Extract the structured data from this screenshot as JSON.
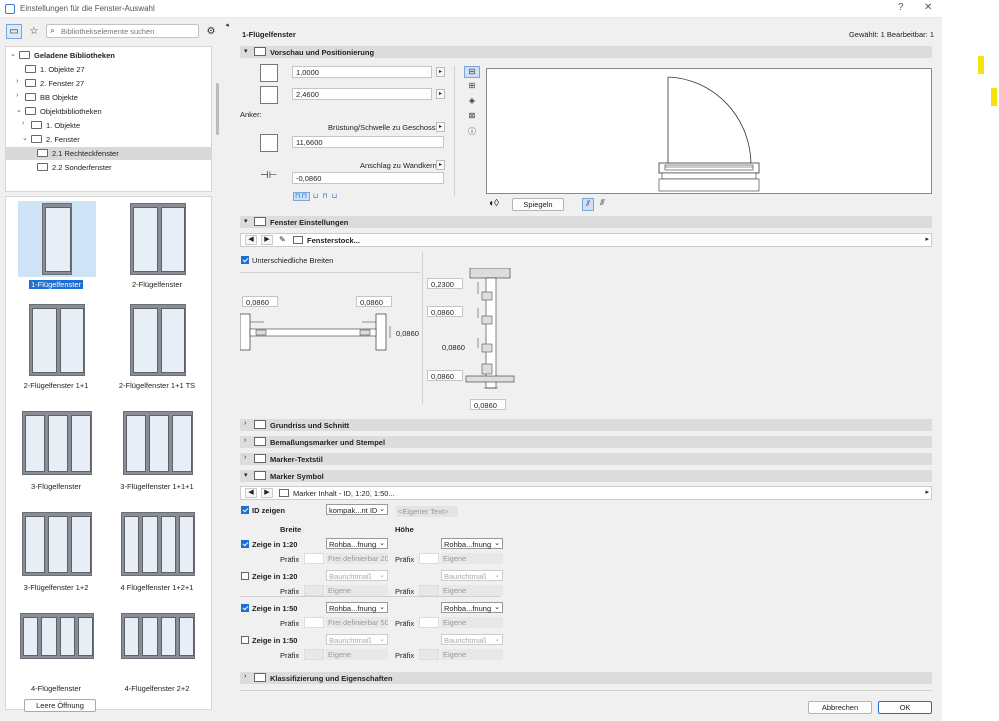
{
  "window": {
    "title": "Einstellungen für die Fenster-Auswahl",
    "help": "?",
    "close": "✕"
  },
  "left": {
    "search_placeholder": "Bibliothekselemente suchen",
    "tree": [
      {
        "label": "Geladene Bibliotheken",
        "bold": true
      },
      {
        "label": "1. Objekte 27"
      },
      {
        "label": "2. Fenster 27"
      },
      {
        "label": "BB Objekte"
      },
      {
        "label": "Objektbibliotheken"
      },
      {
        "label": "1. Objekte"
      },
      {
        "label": "2. Fenster"
      },
      {
        "label": "2.1 Rechteckfenster"
      },
      {
        "label": "2.2 Sonderfenster"
      }
    ],
    "items": [
      {
        "label": "1-Flügelfenster",
        "panes": 1
      },
      {
        "label": "2-Flügelfenster",
        "panes": 2
      },
      {
        "label": "2-Flügelfenster 1+1",
        "panes": 2
      },
      {
        "label": "2-Flügelfenster 1+1 TS",
        "panes": 2
      },
      {
        "label": "3-Flügelfenster",
        "panes": 3
      },
      {
        "label": "3-Flügelfenster 1+1+1",
        "panes": 3
      },
      {
        "label": "3-Flügelfenster 1+2",
        "panes": 3
      },
      {
        "label": "4 Flügelfenster 1+2+1",
        "panes": 4
      },
      {
        "label": "4-Flügelfenster",
        "panes": 4
      },
      {
        "label": "4-Flügelfenster 2+2",
        "panes": 4
      }
    ],
    "empty_opening_button": "Leere Öffnung"
  },
  "right": {
    "title": "1-Flügelfenster",
    "selection_info": "Gewählt: 1 Bearbeitbar: 1",
    "sections": {
      "preview": "Vorschau und Positionierung",
      "window_settings": "Fenster Einstellungen",
      "plan": "Grundriss und Schnitt",
      "dim": "Bemaßungsmarker und Stempel",
      "marker_text": "Marker-Textstil",
      "marker_symbol": "Marker Symbol",
      "class": "Klassifizierung und Eigenschaften"
    },
    "width_val": "1,0000",
    "height_val": "2,4600",
    "anchor_label": "Anker:",
    "sill_label": "Brüstung/Schwelle zu Geschoss 0",
    "sill_val": "11,6600",
    "reveal_label": "Anschlag zu Wandkern",
    "reveal_val": "-0,0860",
    "mirror_button": "Spiegeln",
    "frame_nav": "Fensterstock...",
    "diff_widths": "Unterschiedliche Breiten",
    "dims": {
      "left": "0,0860",
      "right": "0,0860",
      "side": "0,0860",
      "top": "0,2300",
      "m1": "0,0860",
      "m2": "0,0860",
      "m3": "0,0860",
      "bottom": "0,0860"
    },
    "marker_nav": "Marker Inhalt - ID, 1:20, 1:50...",
    "id_show": "ID zeigen",
    "id_select": "kompak...nt ID",
    "own_text": "<Eigener Text>",
    "col_width": "Breite",
    "col_height": "Höhe",
    "rows": [
      {
        "label": "Zeige  in 1:20",
        "checked": true,
        "w": "Rohba...fnung",
        "h": "Rohba...fnung",
        "prefix": "Präfix",
        "free": "Frei definierbar 20",
        "own": "Eigene",
        "enabled": true
      },
      {
        "label": "Zeige  in 1:20",
        "checked": false,
        "w": "Baurichtmaß",
        "h": "Baurichtmaß",
        "prefix": "Präfix",
        "free": "Eigene",
        "own": "Eigene",
        "enabled": false
      },
      {
        "label": "Zeige  in 1:50",
        "checked": true,
        "w": "Rohba...fnung",
        "h": "Rohba...fnung",
        "prefix": "Präfix",
        "free": "Frei definierbar 50",
        "own": "Eigene",
        "enabled": true
      },
      {
        "label": "Zeige  in 1:50",
        "checked": false,
        "w": "Baurichtmaß",
        "h": "Baurichtmaß",
        "prefix": "Präfix",
        "free": "Eigene",
        "own": "Eigene",
        "enabled": false
      }
    ],
    "cancel": "Abbrechen",
    "ok": "OK"
  },
  "colors": {
    "accent": "#1f6fd1",
    "highlight": "#f4e20b"
  }
}
